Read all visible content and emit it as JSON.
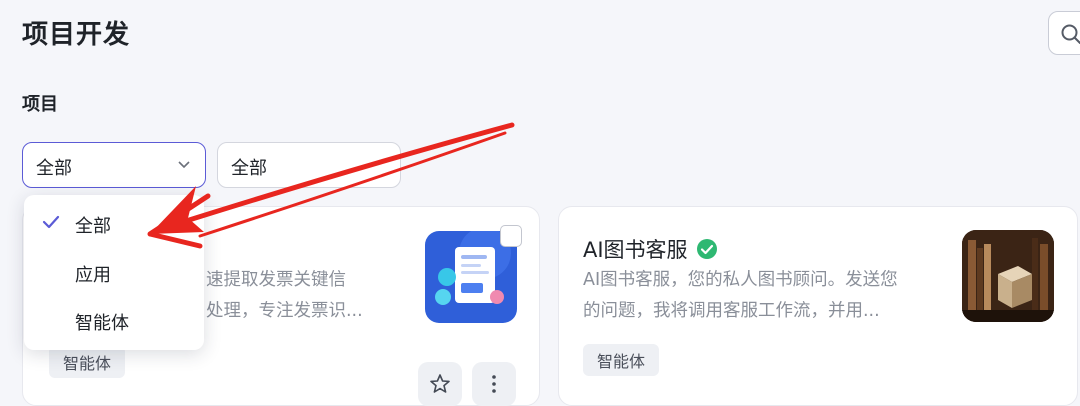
{
  "header": {
    "title": "项目开发"
  },
  "filters": {
    "section_label": "项目",
    "type_select": {
      "value": "全部"
    },
    "second_select": {
      "value": "全部"
    }
  },
  "dropdown": {
    "options": [
      {
        "label": "全部",
        "selected": true
      },
      {
        "label": "应用",
        "selected": false
      },
      {
        "label": "智能体",
        "selected": false
      }
    ]
  },
  "cards": [
    {
      "desc_line1": "速提取发票关键信",
      "desc_line2": "处理，专注发票识...",
      "tag": "智能体"
    },
    {
      "title": "AI图书客服",
      "desc_line1": "AI图书客服，您的私人图书顾问。发送您",
      "desc_line2": "的问题，我将调用客服工作流，并用...",
      "tag": "智能体"
    }
  ],
  "colors": {
    "accent": "#5b5bd6",
    "verified": "#2eb872",
    "annotation_arrow": "#e8261f"
  },
  "icons": [
    "search-icon",
    "chevron-down-icon",
    "check-icon",
    "verified-icon",
    "star-icon",
    "more-icon"
  ]
}
